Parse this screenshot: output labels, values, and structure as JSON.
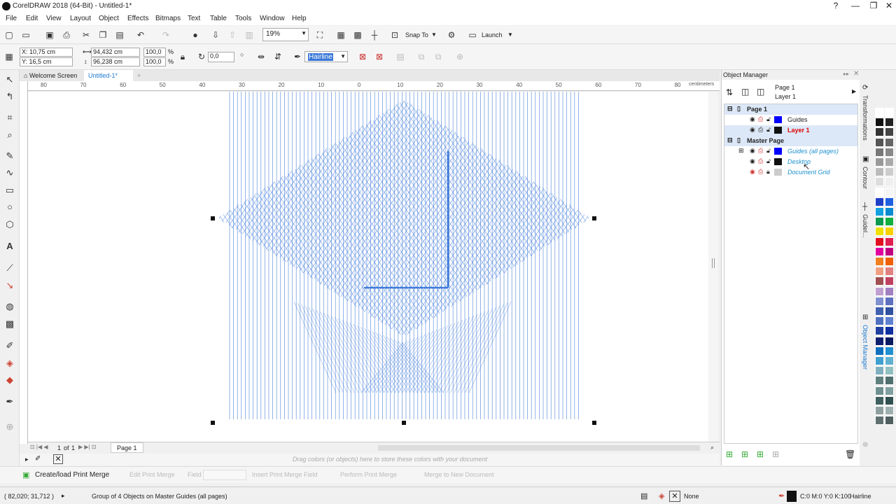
{
  "app": {
    "title": "CorelDRAW 2018 (64-Bit) - Untitled-1*",
    "window_controls": [
      "?",
      "—",
      "❐",
      "✕"
    ]
  },
  "menu": [
    "File",
    "Edit",
    "View",
    "Layout",
    "Object",
    "Effects",
    "Bitmaps",
    "Text",
    "Table",
    "Tools",
    "Window",
    "Help"
  ],
  "toolbar": {
    "zoom": "19%",
    "snap_to": "Snap To",
    "launch": "Launch"
  },
  "propbar": {
    "x": "X: 10,75 cm",
    "y": "Y: 16,5 cm",
    "w": "94,432 cm",
    "h": "96,238 cm",
    "scale_w": "100,0",
    "scale_h": "100,0",
    "pct": "%",
    "rotation": "0,0",
    "outline": "Hairline"
  },
  "tabs": [
    "Welcome Screen",
    "Untitled-1*"
  ],
  "ruler": {
    "h_ticks": [
      "80",
      "70",
      "60",
      "50",
      "40",
      "30",
      "20",
      "10",
      "0",
      "10",
      "20",
      "30",
      "40",
      "50",
      "60",
      "70",
      "80"
    ],
    "unit": "centimeters"
  },
  "page_nav": {
    "current": "1",
    "of": "of",
    "total": "1",
    "page_tab": "Page 1"
  },
  "palette_hint": "Drag colors (or objects) here to store these colors with your document",
  "merge": {
    "create": "Create/load Print Merge",
    "edit": "Edit Print Merge",
    "field": "Field",
    "insert": "Insert Print Merge Field",
    "perform": "Perform Print Merge",
    "merge_new": "Merge to New Document"
  },
  "status": {
    "coords": "( 82,020; 31,712 )",
    "info": "Group of 4 Objects on Master Guides (all pages)",
    "fill": "None",
    "outline_color": "C:0 M:0 Y:0 K:100",
    "outline_width": "Hairline"
  },
  "object_manager": {
    "title": "Object Manager",
    "page": "Page 1",
    "layer": "Layer 1",
    "tree": [
      {
        "label": "Page 1",
        "kind": "page"
      },
      {
        "label": "Guides",
        "kind": "layer",
        "color": "#0000ff",
        "text_color": "#222222"
      },
      {
        "label": "Layer 1",
        "kind": "layer",
        "color": "#111111",
        "text_color": "#e00000"
      },
      {
        "label": "Master Page",
        "kind": "page"
      },
      {
        "label": "Guides (all pages)",
        "kind": "layer",
        "color": "#0000ff",
        "text_color": "#1e90d0"
      },
      {
        "label": "Desktop",
        "kind": "layer",
        "color": "#111111",
        "text_color": "#1e90d0"
      },
      {
        "label": "Document Grid",
        "kind": "layer",
        "color": "#cccccc",
        "text_color": "#1e90d0"
      }
    ]
  },
  "docker_tabs": [
    "Transformations",
    "Contour",
    "Guidel...",
    "Object Manager"
  ],
  "colors": {
    "grid": "#2f6fd6",
    "selected_tab": "#1e90ff"
  }
}
